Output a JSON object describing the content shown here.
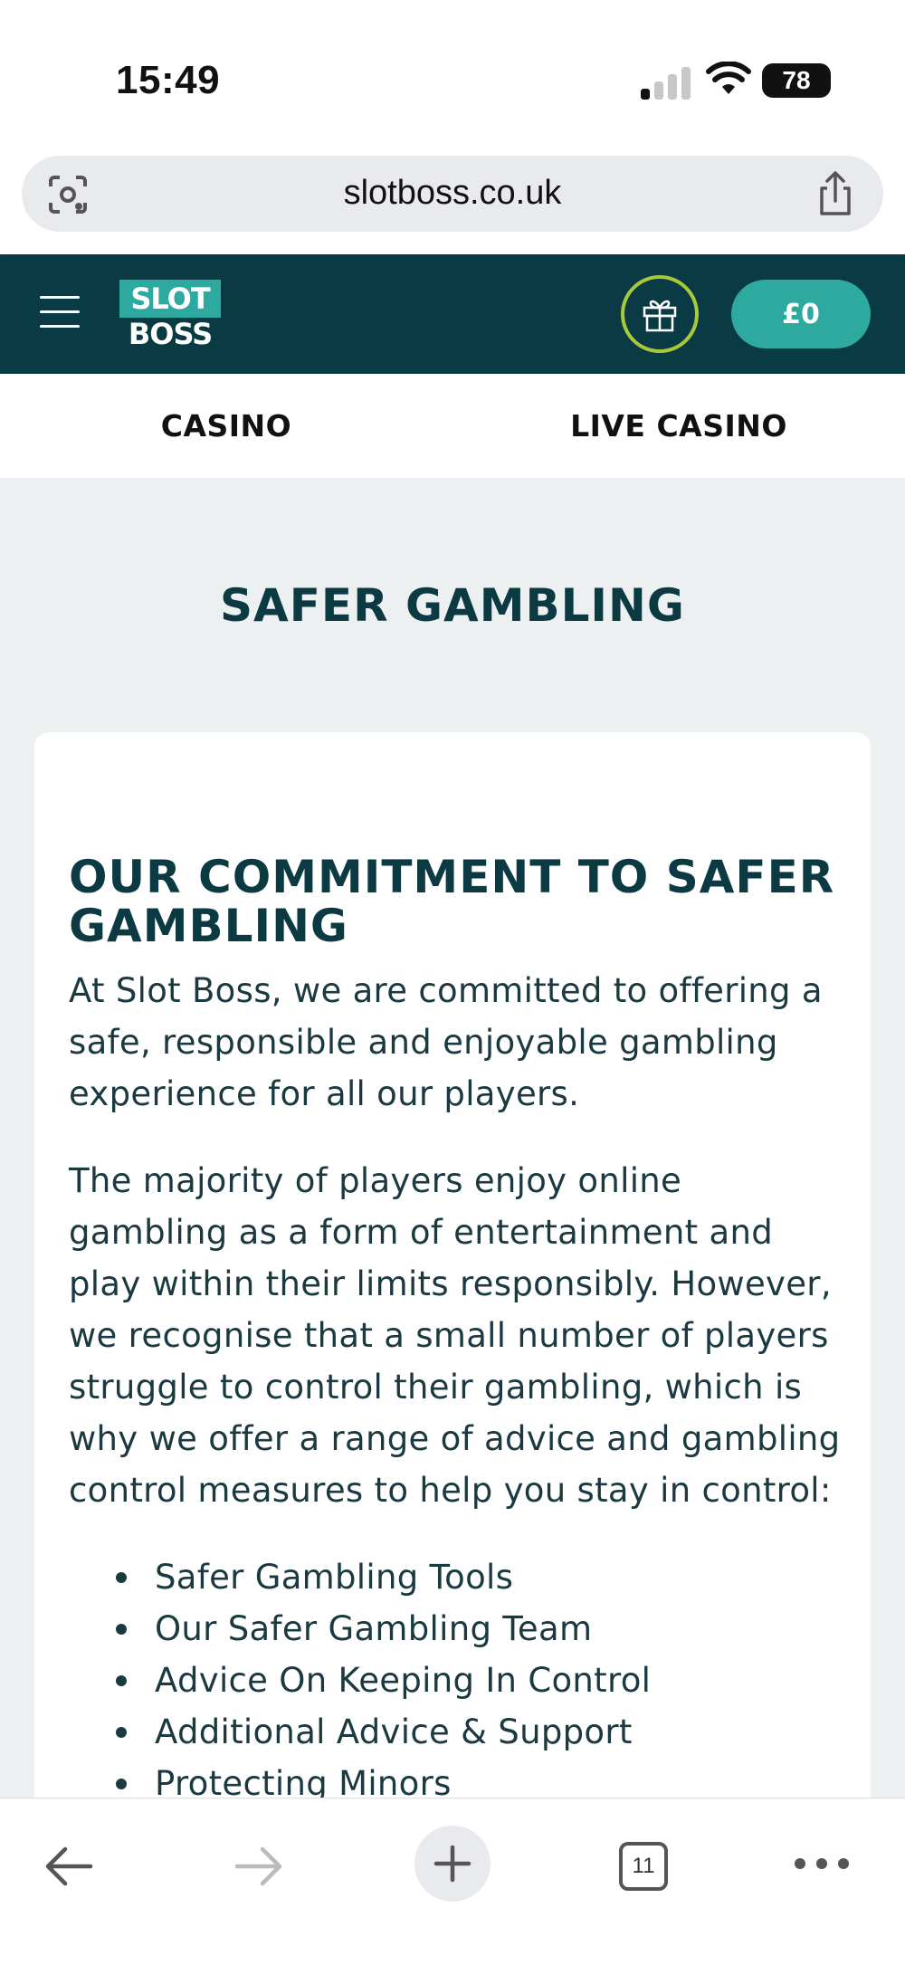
{
  "status_bar": {
    "time": "15:49",
    "battery": "78"
  },
  "browser": {
    "url": "slotboss.co.uk",
    "tabs_count": "11"
  },
  "site": {
    "logo_top": "SLOT",
    "logo_bottom": "BOSS",
    "balance": "£0",
    "colors": {
      "header_bg": "#0a3b44",
      "accent": "#2ea9a0",
      "gift_ring": "#a8c93a"
    }
  },
  "nav": {
    "tabs": [
      {
        "label": "CASINO"
      },
      {
        "label": "LIVE CASINO"
      }
    ]
  },
  "page": {
    "title": "SAFER GAMBLING",
    "card": {
      "heading": "OUR COMMITMENT TO SAFER GAMBLING",
      "paragraph1": "At Slot Boss, we are committed to offering a safe, responsible and enjoyable gambling experience for all our players.",
      "paragraph2": "The majority of players enjoy online gambling as a form of entertainment and play within their limits responsibly. However, we recognise that a small number of players struggle to control their gambling, which is why we offer a range of advice and gambling control measures to help you stay in control:",
      "list": [
        "Safer Gambling Tools",
        "Our Safer Gambling Team",
        "Advice On Keeping In Control",
        "Additional Advice & Support",
        "Protecting Minors"
      ]
    }
  },
  "icons": {
    "url_left": "visual-search-icon",
    "url_right": "share-icon",
    "menu": "hamburger-menu-icon",
    "gift": "gift-icon",
    "back": "back-arrow-icon",
    "forward": "forward-arrow-icon",
    "new_tab": "plus-icon",
    "more": "more-dots-icon"
  }
}
